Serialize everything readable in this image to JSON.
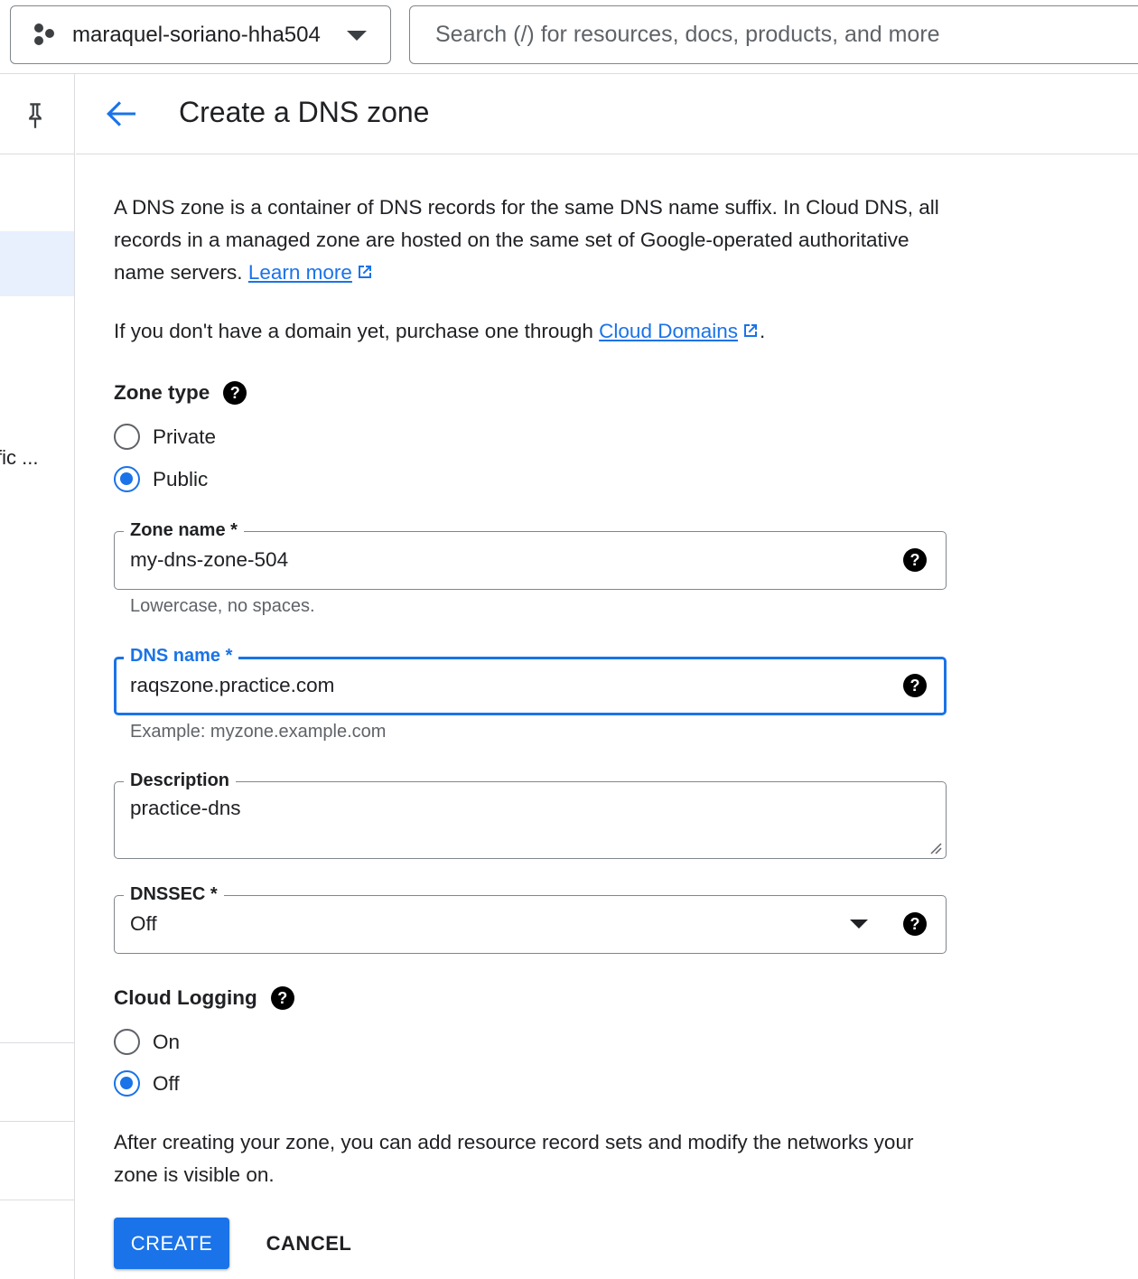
{
  "topbar": {
    "project_name": "maraquel-soriano-hha504",
    "search_placeholder": "Search (/) for resources, docs, products, and more"
  },
  "rail": {
    "truncated_item": "fic ..."
  },
  "header": {
    "title": "Create a DNS zone"
  },
  "intro": {
    "text": "A DNS zone is a container of DNS records for the same DNS name suffix. In Cloud DNS, all records in a managed zone are hosted on the same set of Google-operated authoritative name servers.",
    "learn_more": "Learn more",
    "domain_text": "If you don't have a domain yet, purchase one through",
    "cloud_domains": "Cloud Domains",
    "domain_end": "."
  },
  "zone_type": {
    "label": "Zone type",
    "options": [
      "Private",
      "Public"
    ],
    "selected": "Public"
  },
  "zone_name": {
    "label": "Zone name *",
    "value": "my-dns-zone-504",
    "hint": "Lowercase, no spaces."
  },
  "dns_name": {
    "label": "DNS name *",
    "value": "raqszone.practice.com",
    "hint": "Example: myzone.example.com"
  },
  "description": {
    "label": "Description",
    "value": "practice-dns"
  },
  "dnssec": {
    "label": "DNSSEC *",
    "value": "Off"
  },
  "cloud_logging": {
    "label": "Cloud Logging",
    "options": [
      "On",
      "Off"
    ],
    "selected": "Off"
  },
  "footer_text": "After creating your zone, you can add resource record sets and modify the networks your zone is visible on.",
  "buttons": {
    "create": "CREATE",
    "cancel": "CANCEL"
  },
  "colors": {
    "accent": "#1a73e8",
    "border": "#80868b",
    "selected_bg": "#e8f0fe"
  },
  "icons": [
    "project-icon",
    "chevron-down-icon",
    "pin-icon",
    "back-arrow-icon",
    "external-link-icon",
    "help-icon",
    "dropdown-arrow-icon",
    "resize-handle-icon"
  ]
}
